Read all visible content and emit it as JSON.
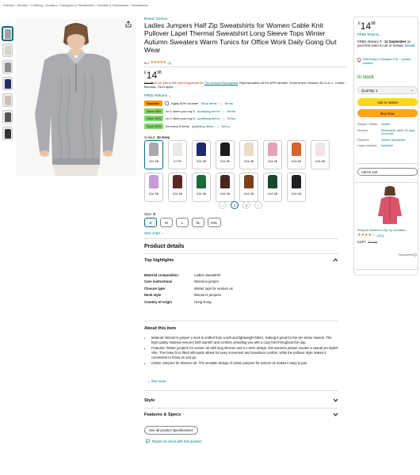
{
  "breadcrumb": "Fashion › Women › Clothing › Jumpers, Cardigans & Sweatshirts › Hoodies & Sweatshirts › Sweatshirts",
  "product": {
    "brand": "Brand: Gemeo",
    "title": "Ladies Jumpers Half Zip Sweatshirts for Women Cable Knit Pullover Lapel Thermal Sweatshirt Long Sleeve Tops Winter Autumn Sweaters Warm Tunics for Office Work Daily Going Out Wear",
    "rating_value": "5.0",
    "rating_stars": "★★★★★",
    "rating_count": "(1)",
    "price_symbol": "£",
    "price_whole": "14",
    "price_fraction": "98",
    "promo_struck": "£14.98",
    "promo_text": "£0.00 with a Gift Card if approved for",
    "promo_link": "The Amazon Barclaycard",
    "promo_rest": ". Representative 28.9% APR variable. Credit broker: Amazon EU S.à.r.l.. Lender: Barclays. T&Cs apply.",
    "free_returns": "FREE Returns"
  },
  "offers": [
    {
      "tag": "Voucher:",
      "text": "Apply 50% voucher",
      "link": "Shop items ›",
      "terms": "Terms"
    },
    {
      "tag": "Save 15%",
      "text": "on 1 when you buy 2",
      "link": "qualifying items ›",
      "terms": "Terms"
    },
    {
      "tag": "Save 30%",
      "text": "on 1 when you buy 4",
      "link": "qualifying items ›",
      "terms": "Terms"
    },
    {
      "tag": "Save 50%",
      "text": "for every 6 items",
      "link": "qualifying items ›",
      "terms": "Terms"
    }
  ],
  "colour": {
    "label": "Colour:",
    "selected": "10 Grey"
  },
  "swatches": [
    {
      "price": "£14.98",
      "color": "#a7a9ad"
    },
    {
      "price": "£7.99",
      "color": "#e9e9e6"
    },
    {
      "price": "£14.98",
      "color": "#1d2b6e"
    },
    {
      "price": "£14.98",
      "color": "#1a1a1a"
    },
    {
      "price": "£14.98",
      "color": "#e9dccb"
    },
    {
      "price": "£14.98",
      "color": "#e8a1b6"
    },
    {
      "price": "£14.98",
      "color": "#d9652a"
    },
    {
      "price": "£14.98",
      "color": "#f3e4e8"
    },
    {
      "price": "£14.98",
      "color": "#c79ad9"
    },
    {
      "price": "£14.98",
      "color": "#5a2a22"
    },
    {
      "price": "£14.98",
      "color": "#1b6a3a"
    },
    {
      "price": "£14.98",
      "color": "#4a2620"
    },
    {
      "price": "£14.98",
      "color": "#7b3f1c"
    },
    {
      "price": "£14.98",
      "color": "#18482f"
    },
    {
      "price": "£14.98",
      "color": "#1f1f23"
    }
  ],
  "pager": {
    "prev": "‹",
    "pages": [
      "1",
      "2"
    ],
    "next": "›"
  },
  "size": {
    "label": "Size:",
    "selected": "S",
    "options": [
      "S",
      "M",
      "L",
      "XL",
      "XXL"
    ],
    "chart": "Size chart"
  },
  "details": {
    "heading": "Product details",
    "highlights_heading": "Top highlights",
    "rows": [
      {
        "k": "Material composition",
        "v": "Ladies sweatshirt"
      },
      {
        "k": "Care instructions",
        "v": "Womens jumper"
      },
      {
        "k": "Closure type",
        "v": "Winter tops for women uk"
      },
      {
        "k": "Neck style",
        "v": "Women's jumpers"
      },
      {
        "k": "Country of origin",
        "v": "Hong Kong"
      }
    ]
  },
  "about": {
    "heading": "About this item",
    "bullets": [
      "Material: Women's jumper v neck is crafted from a soft and lightweight fabric, making it great for the UK winter season. The high-quality material ensures both warmth and comfort, providing you with a cozy feel throughout the day.",
      "Features: Winter jumpers for women uk with long sleeves and a v-neck design, this womens jumper exudes a casual yet stylish vibe. The loose fit or fitted silhouette allows for easy movement and maximum comfort, while the pullover style makes it convenient to throw on and go.",
      "Cotton Jumpers for Women Uk: The versatile design of cotton jumpers for women uk makes it easy to pair"
    ],
    "see_more": "See more"
  },
  "sections": {
    "style": "Style",
    "features": "Features & Specs",
    "all_specs": "See all product specifications",
    "report": "Report an issue with this product"
  },
  "buybox": {
    "price_symbol": "£",
    "price_whole": "14",
    "price_fraction": "98",
    "free_returns": "FREE Returns",
    "delivery_prefix": "FREE delivery",
    "delivery_date": "7 - 12 September",
    "delivery_suffix": "on your first order to UK or Ireland.",
    "details": "Details",
    "deliver_to": "Delivering to Glasgow G31 - Update location",
    "stock": "In stock",
    "quantity": "Quantity: 1",
    "add_to_basket": "Add to basket",
    "buy_now": "Buy Now",
    "specs": [
      {
        "k": "Shipper / Seller",
        "v": "Nolaze"
      },
      {
        "k": "Returns",
        "v": "Returnable within 30 days of receipt"
      },
      {
        "k": "Payment",
        "v": "Secure transaction"
      },
      {
        "k": "Legal warranty",
        "v": "Available"
      }
    ],
    "add_to_list": "Add to List",
    "accent_color": "#ffd814",
    "buy_color": "#ffa41c",
    "stock_color": "#007600"
  },
  "sponsored_ad": {
    "title": "Sharpm Women's Zip Up Hoodies...",
    "stars": "★★★★☆",
    "count": "(119)",
    "price": "£19⁹⁹",
    "was": "£22.99",
    "label": "Sponsored"
  }
}
